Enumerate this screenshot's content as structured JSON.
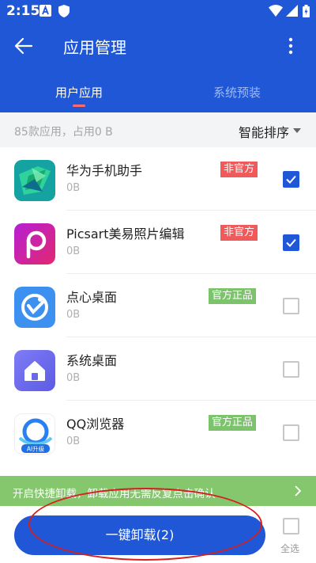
{
  "status_bar": {
    "time": "2:15",
    "icons": [
      "a-notification-icon",
      "shield-icon",
      "wifi-icon",
      "signal-icon",
      "battery-icon"
    ]
  },
  "app_bar": {
    "title": "应用管理",
    "back_icon": "arrow-left-icon",
    "more_icon": "more-vert-icon"
  },
  "tabs": [
    {
      "label": "用户应用",
      "active": true
    },
    {
      "label": "系统预装",
      "active": false
    }
  ],
  "summary": {
    "count_text": "85款应用，占用0 B",
    "sort_label": "智能排序"
  },
  "apps": [
    {
      "name": "华为手机助手",
      "size": "0B",
      "badge": "非官方",
      "badge_type": "unofficial",
      "checked": true,
      "icon": "huawei-assistant-icon"
    },
    {
      "name": "Picsart美易照片编辑",
      "size": "0B",
      "badge": "非官方",
      "badge_type": "unofficial",
      "checked": true,
      "icon": "picsart-icon"
    },
    {
      "name": "点心桌面",
      "size": "0B",
      "badge": "官方正品",
      "badge_type": "official",
      "checked": false,
      "icon": "dianxin-desktop-icon"
    },
    {
      "name": "系统桌面",
      "size": "0B",
      "badge": "",
      "badge_type": "",
      "checked": false,
      "icon": "home-icon"
    },
    {
      "name": "QQ浏览器",
      "size": "0B",
      "badge": "官方正品",
      "badge_type": "official",
      "checked": false,
      "icon": "qq-browser-icon",
      "icon_caption": "AI升级"
    }
  ],
  "banner": {
    "text": "开启快捷卸载，卸载应用无需反复点击确认"
  },
  "bottom": {
    "uninstall_label": "一键卸载(2)",
    "select_all_label": "全选"
  },
  "colors": {
    "primary": "#1f57d6",
    "unofficial_badge": "#f05a5a",
    "official_badge": "#7cc46b",
    "banner": "#84c76d",
    "highlight_ring": "#d81e1e"
  }
}
